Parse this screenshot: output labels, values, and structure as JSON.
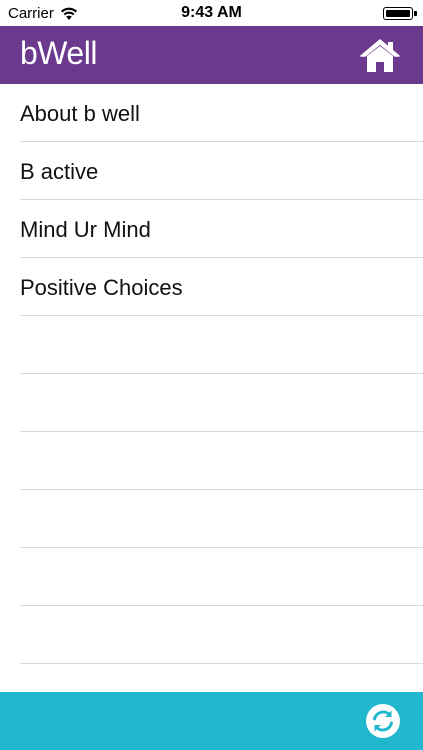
{
  "status_bar": {
    "carrier": "Carrier",
    "time": "9:43 AM",
    "wifi_icon": "wifi-icon",
    "battery_icon": "battery-icon",
    "battery_level": 1.0
  },
  "nav": {
    "title": "bWell",
    "home_icon": "home-icon",
    "background_color": "#6b3a8e"
  },
  "list": {
    "items": [
      {
        "label": "About b well"
      },
      {
        "label": "B active"
      },
      {
        "label": "Mind Ur Mind"
      },
      {
        "label": "Positive Choices"
      },
      {
        "label": ""
      },
      {
        "label": ""
      },
      {
        "label": ""
      },
      {
        "label": ""
      },
      {
        "label": ""
      },
      {
        "label": ""
      }
    ]
  },
  "toolbar": {
    "refresh_icon": "refresh-icon",
    "background_color": "#21b7cf"
  }
}
